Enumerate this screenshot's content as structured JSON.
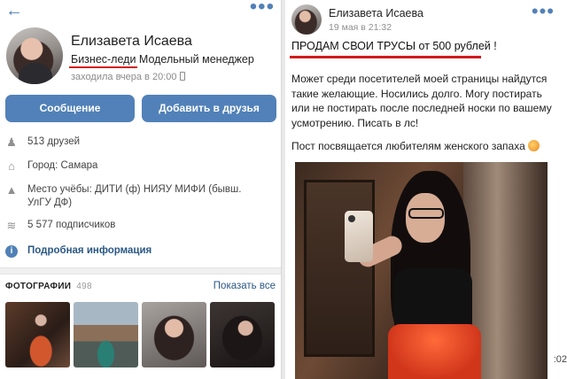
{
  "profile": {
    "name": "Елизавета Исаева",
    "status_accent": "Бизнес-леди",
    "status_rest": " Модельный менеджер",
    "last_seen": "заходила вчера в 20:00",
    "buttons": {
      "message": "Сообщение",
      "add_friend": "Добавить в друзья"
    },
    "info": {
      "friends": "513 друзей",
      "city": "Город: Самара",
      "education_line1": "Место учёбы: ДИТИ (ф) НИЯУ МИФИ (бывш.",
      "education_line2": "УлГУ ДФ)",
      "subscribers": "5 577 подписчиков",
      "details": "Подробная информация"
    },
    "photos": {
      "heading": "ФОТОГРАФИИ",
      "count": "498",
      "show_all": "Показать все"
    }
  },
  "post": {
    "author": "Елизавета Исаева",
    "date": "19 мая в 21:32",
    "headline": "ПРОДАМ СВОИ ТРУСЫ от 500 рублей !",
    "body": "Может среди посетителей моей страницы найдутся такие желающие. Носились долго. Могу постирать или не постирать после последней носки по вашему усмотрению. Писать в лс!",
    "footnote": "Пост посвящается любителям женского запаха",
    "edge_time": ":02"
  },
  "icons": {
    "back": "back-arrow-icon",
    "more": "more-dots-icon",
    "friends": "friends-icon",
    "city": "home-icon",
    "education": "graduation-cap-icon",
    "subscribers": "rss-icon",
    "details": "info-icon",
    "phone": "phone-icon",
    "emoji": "peach-emoji-icon"
  },
  "colors": {
    "accent": "#5181b8",
    "link": "#2a5885",
    "highlight": "#d21a1a"
  }
}
